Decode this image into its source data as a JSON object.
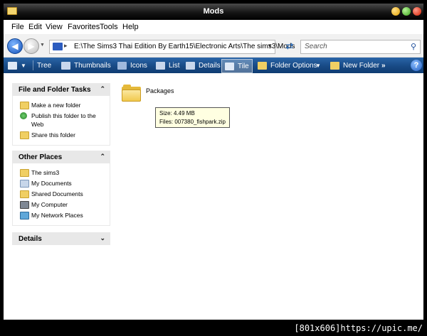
{
  "window": {
    "title": "Mods"
  },
  "menu": [
    "File",
    "Edit",
    "View",
    "Favorites",
    "Tools",
    "Help"
  ],
  "address": {
    "path": "E:\\The Sims3 Thai Edition By Earth15\\Electronic Arts\\The sims3\\Mods",
    "search_placeholder": "Search"
  },
  "toolbar": {
    "items": [
      "Tree",
      "Thumbnails",
      "Icons",
      "List",
      "Details",
      "Tile",
      "Folder Options",
      "New Folder"
    ],
    "active": "Tile",
    "overflow": "»",
    "help": "?"
  },
  "panels": {
    "file_tasks": {
      "title": "File and Folder Tasks",
      "items": [
        "Make a new folder",
        "Publish this folder to the Web",
        "Share this folder"
      ]
    },
    "other_places": {
      "title": "Other Places",
      "items": [
        "The sims3",
        "My Documents",
        "Shared Documents",
        "My Computer",
        "My Network Places"
      ]
    },
    "details": {
      "title": "Details"
    }
  },
  "files": [
    {
      "name": "Packages"
    }
  ],
  "tooltip": {
    "size": "Size: 4.49 MB",
    "files": "Files: 007380_fishpark.zip"
  },
  "watermark": "[801x606]https://upic.me/"
}
